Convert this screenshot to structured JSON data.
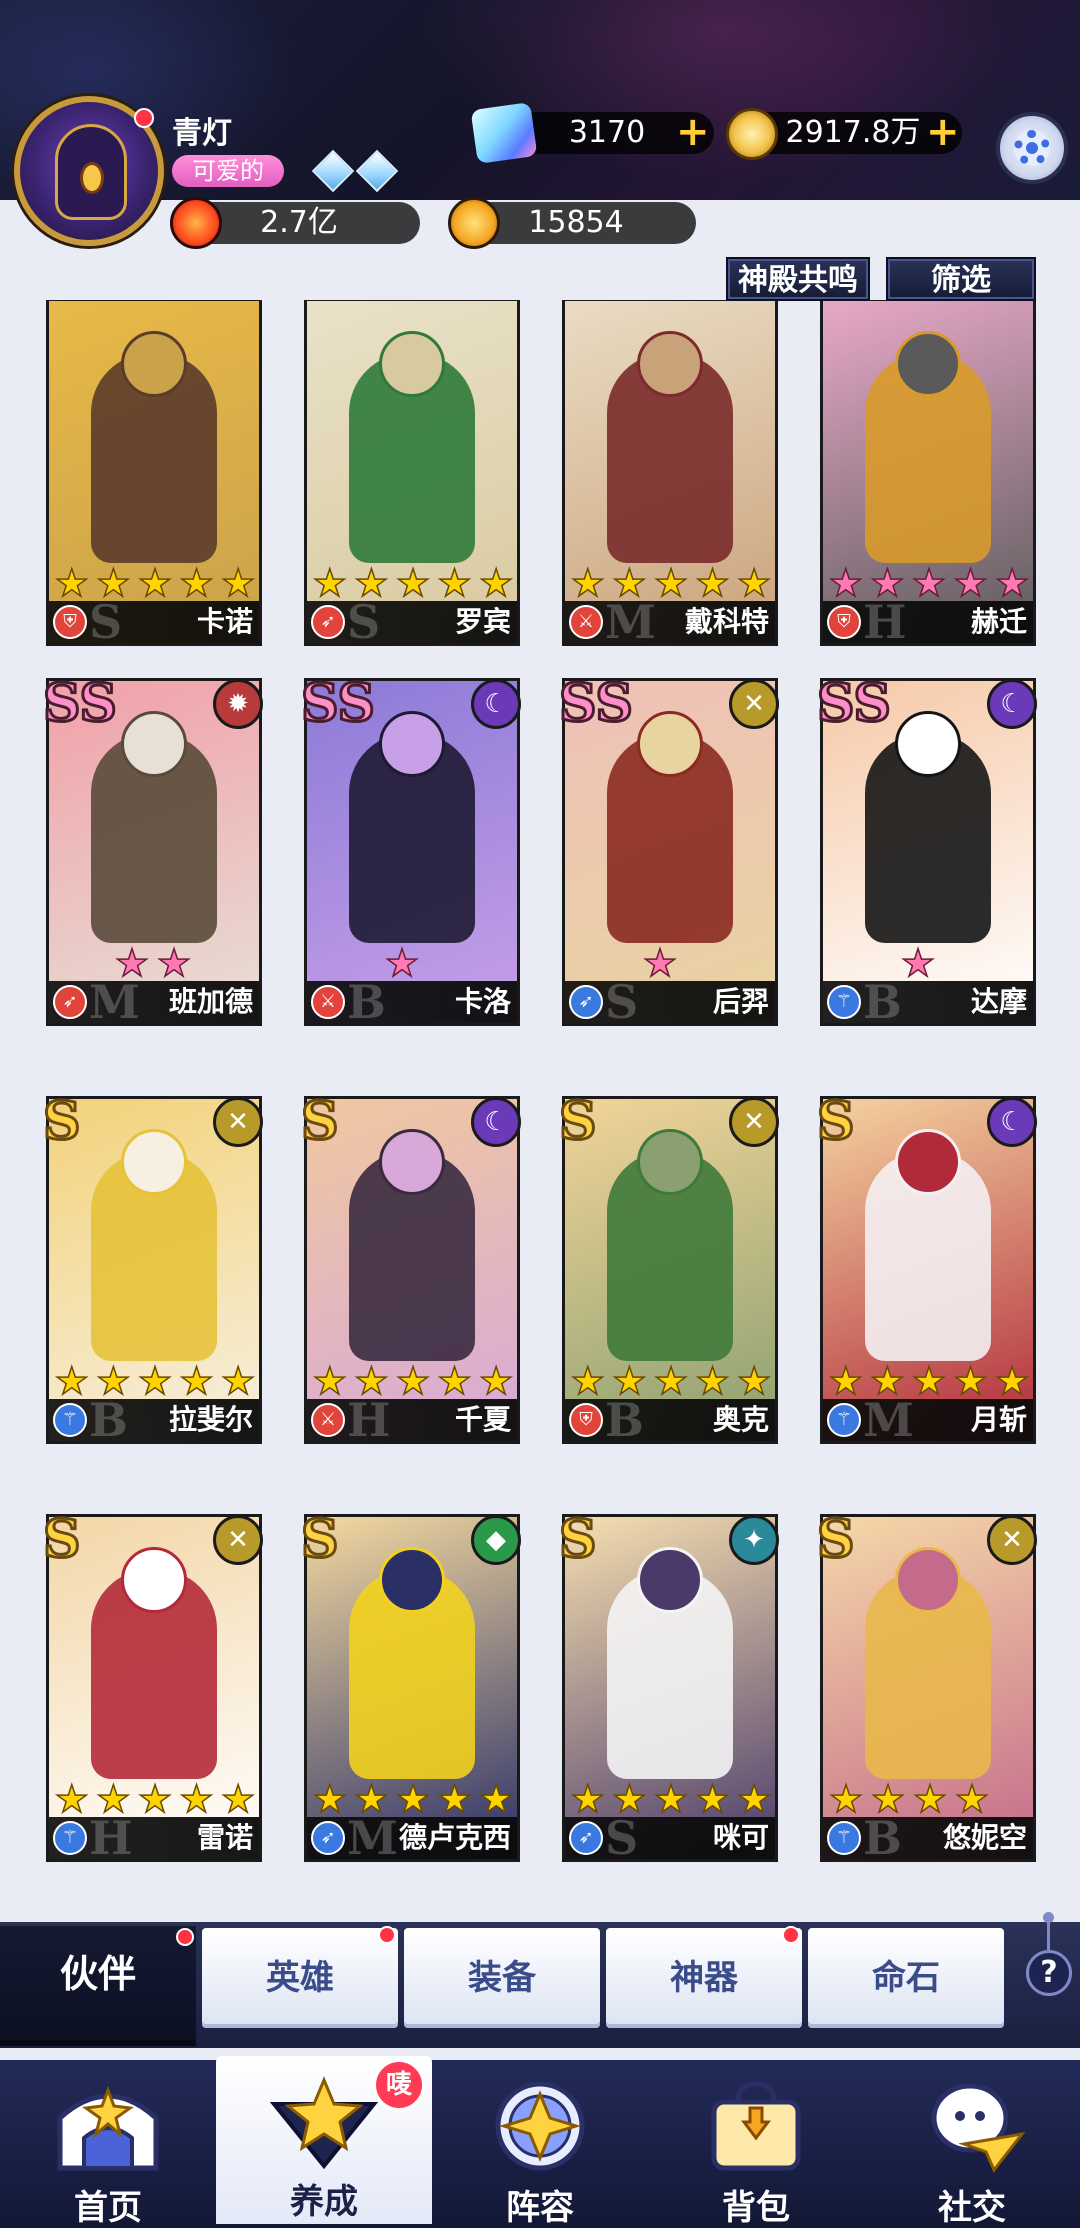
{
  "player": {
    "name": "青灯",
    "tag": "可爱的",
    "power": "2.7亿",
    "points": "15854"
  },
  "resources": {
    "gems": "3170",
    "gold": "2917.8万"
  },
  "filters": {
    "resonance": "神殿共鸣",
    "filter": "筛选"
  },
  "heroes": [
    {
      "name": "卡诺",
      "rank": "",
      "stars": 5,
      "star_color": "gold",
      "tier": "S",
      "cls": "shield"
    },
    {
      "name": "罗宾",
      "rank": "",
      "stars": 5,
      "star_color": "gold",
      "tier": "S",
      "cls": "bow"
    },
    {
      "name": "戴科特",
      "rank": "",
      "stars": 5,
      "star_color": "gold",
      "tier": "M",
      "cls": "sword"
    },
    {
      "name": "赫迁",
      "rank": "",
      "stars": 5,
      "star_color": "pink",
      "tier": "H",
      "cls": "shield"
    },
    {
      "name": "班加德",
      "rank": "SS",
      "stars": 2,
      "star_color": "pink",
      "tier": "M",
      "cls": "bow"
    },
    {
      "name": "卡洛",
      "rank": "SS",
      "stars": 1,
      "star_color": "pink",
      "tier": "B",
      "cls": "sword"
    },
    {
      "name": "后羿",
      "rank": "SS",
      "stars": 1,
      "star_color": "pink",
      "tier": "S",
      "cls": "bow"
    },
    {
      "name": "达摩",
      "rank": "SS",
      "stars": 1,
      "star_color": "pink",
      "tier": "B",
      "cls": "staff"
    },
    {
      "name": "拉斐尔",
      "rank": "S",
      "stars": 5,
      "star_color": "gold",
      "tier": "B",
      "cls": "staff"
    },
    {
      "name": "千夏",
      "rank": "S",
      "stars": 5,
      "star_color": "gold",
      "tier": "H",
      "cls": "sword"
    },
    {
      "name": "奥克",
      "rank": "S",
      "stars": 5,
      "star_color": "gold",
      "tier": "B",
      "cls": "shield"
    },
    {
      "name": "月斩",
      "rank": "S",
      "stars": 5,
      "star_color": "gold",
      "tier": "M",
      "cls": "staff"
    },
    {
      "name": "雷诺",
      "rank": "S",
      "stars": 5,
      "star_color": "gold",
      "tier": "H",
      "cls": "staff"
    },
    {
      "name": "德卢克西",
      "rank": "S",
      "stars": 5,
      "star_color": "gold",
      "tier": "M",
      "cls": "bow"
    },
    {
      "name": "咪可",
      "rank": "S",
      "stars": 5,
      "star_color": "gold",
      "tier": "S",
      "cls": "bow"
    },
    {
      "name": "悠妮空",
      "rank": "S",
      "stars": 4,
      "star_color": "gold",
      "tier": "B",
      "cls": "staff"
    }
  ],
  "subtabs": [
    "伙伴",
    "英雄",
    "装备",
    "神器",
    "命石"
  ],
  "nav": [
    "首页",
    "养成",
    "阵容",
    "背包",
    "社交"
  ],
  "nav_badge": "唛",
  "help_label": "?"
}
